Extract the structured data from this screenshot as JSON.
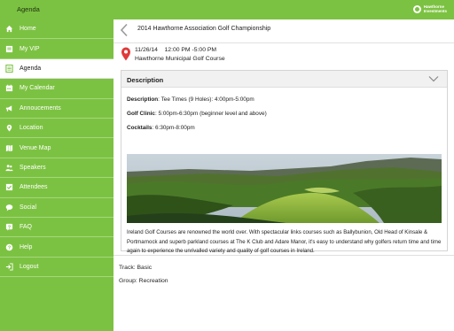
{
  "app": {
    "title": "Agenda",
    "brand_line1": "Hawthorne",
    "brand_line2": "Investments",
    "accent_color": "#7cc242"
  },
  "sidebar": {
    "items": [
      {
        "label": "Home",
        "icon": "home-icon",
        "active": false
      },
      {
        "label": "My VIP",
        "icon": "vip-icon",
        "active": false
      },
      {
        "label": "Agenda",
        "icon": "agenda-icon",
        "active": true
      },
      {
        "label": "My Calendar",
        "icon": "calendar-icon",
        "active": false
      },
      {
        "label": "Annoucements",
        "icon": "megaphone-icon",
        "active": false
      },
      {
        "label": "Location",
        "icon": "location-pin-icon",
        "active": false
      },
      {
        "label": "Venue Map",
        "icon": "map-icon",
        "active": false
      },
      {
        "label": "Speakers",
        "icon": "speakers-icon",
        "active": false
      },
      {
        "label": "Attendees",
        "icon": "attendees-icon",
        "active": false
      },
      {
        "label": "Social",
        "icon": "chat-bubble-icon",
        "active": false
      },
      {
        "label": "FAQ",
        "icon": "faq-icon",
        "active": false
      },
      {
        "label": "Help",
        "icon": "help-icon",
        "active": false
      },
      {
        "label": "Logout",
        "icon": "logout-icon",
        "active": false
      }
    ]
  },
  "event": {
    "title": "2014 Hawthorne Association Golf Championship",
    "datetime": "11/26/14    12:00 PM -5:00 PM",
    "venue": "Hawthorne Municipal Golf Course"
  },
  "description": {
    "header": "Description",
    "lines": [
      {
        "label": "Description",
        "sep": ": ",
        "text": "Tee Times (9 Holes): 4:00pm-5:00pm"
      },
      {
        "label": "Golf Clinic",
        "sep": ": ",
        "text": "5:00pm-6:30pm (beginner level and above)"
      },
      {
        "label": "Cocktails",
        "sep": ": ",
        "text": "6:30pm-8:00pm"
      }
    ],
    "paragraph": "Ireland Golf Courses are renowned the world over. With spectacular links courses such as Ballybunion, Old Head of Kinsale & Portmarnock and superb parkland courses at The K Club and Adare Manor, it's easy to understand why golfers return time and time again to experience the unrivalled variety and quality of golf courses in Ireland."
  },
  "meta": {
    "track": "Track: Basic",
    "group": "Group: Recreation"
  }
}
